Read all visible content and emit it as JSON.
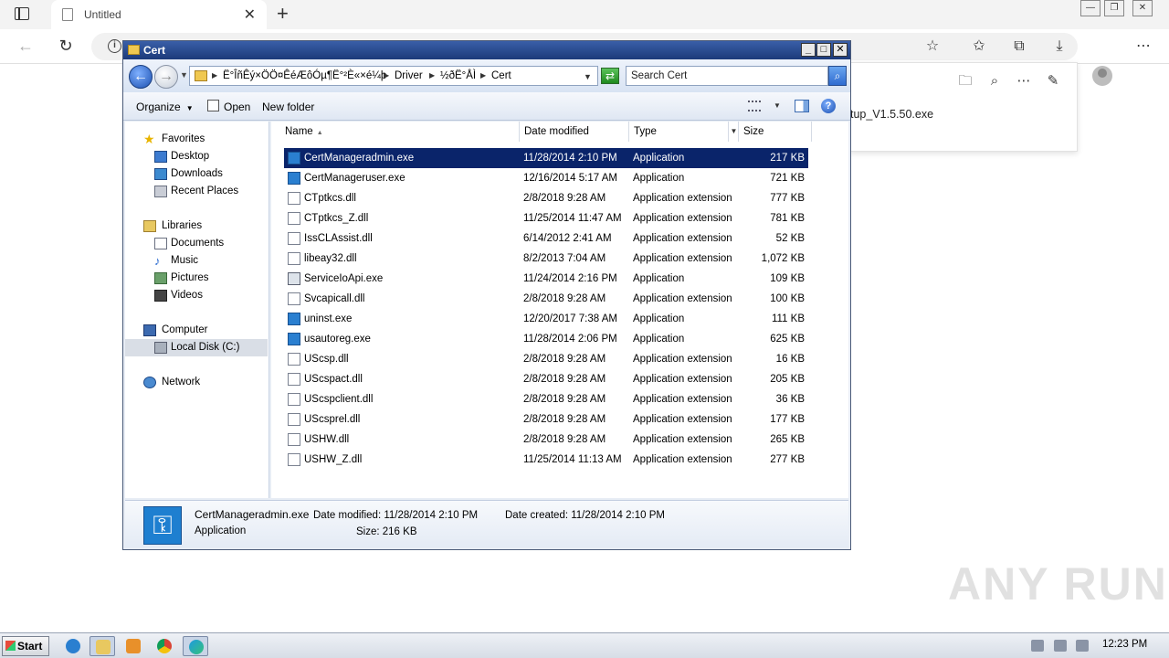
{
  "browser": {
    "tab_title": "Untitled",
    "download_filename": "tup_V1.5.50.exe"
  },
  "explorer": {
    "title": "Cert",
    "breadcrumbs": [
      "Ë°ÎñÊý×ÖÖ¤ÊéÆôÓµ¶Ë°²È«×é¼þ",
      "Driver",
      "½ðË°ÅÌ",
      "Cert"
    ],
    "search_placeholder": "Search Cert",
    "commands": {
      "organize": "Organize",
      "open": "Open",
      "new_folder": "New folder"
    },
    "nav": {
      "favorites": "Favorites",
      "desktop": "Desktop",
      "downloads": "Downloads",
      "recent_places": "Recent Places",
      "libraries": "Libraries",
      "documents": "Documents",
      "music": "Music",
      "pictures": "Pictures",
      "videos": "Videos",
      "computer": "Computer",
      "local_disk": "Local Disk (C:)",
      "network": "Network"
    },
    "columns": {
      "name": "Name",
      "date": "Date modified",
      "type": "Type",
      "size": "Size"
    },
    "files": [
      {
        "name": "CertManageradmin.exe",
        "date": "11/28/2014 2:10 PM",
        "type": "Application",
        "size": "217 KB",
        "icon": "key-icon",
        "selected": true
      },
      {
        "name": "CertManageruser.exe",
        "date": "12/16/2014 5:17 AM",
        "type": "Application",
        "size": "721 KB",
        "icon": "key-icon"
      },
      {
        "name": "CTptkcs.dll",
        "date": "2/8/2018 9:28 AM",
        "type": "Application extension",
        "size": "777 KB",
        "icon": "dll-icon"
      },
      {
        "name": "CTptkcs_Z.dll",
        "date": "11/25/2014 11:47 AM",
        "type": "Application extension",
        "size": "781 KB",
        "icon": "dll-icon"
      },
      {
        "name": "IssCLAssist.dll",
        "date": "6/14/2012 2:41 AM",
        "type": "Application extension",
        "size": "52 KB",
        "icon": "dll-icon"
      },
      {
        "name": "libeay32.dll",
        "date": "8/2/2013 7:04 AM",
        "type": "Application extension",
        "size": "1,072 KB",
        "icon": "dll-icon"
      },
      {
        "name": "ServiceIoApi.exe",
        "date": "11/24/2014 2:16 PM",
        "type": "Application",
        "size": "109 KB",
        "icon": "app-icon"
      },
      {
        "name": "Svcapicall.dll",
        "date": "2/8/2018 9:28 AM",
        "type": "Application extension",
        "size": "100 KB",
        "icon": "dll-icon"
      },
      {
        "name": "uninst.exe",
        "date": "12/20/2017 7:38 AM",
        "type": "Application",
        "size": "111 KB",
        "icon": "key-icon"
      },
      {
        "name": "usautoreg.exe",
        "date": "11/28/2014 2:06 PM",
        "type": "Application",
        "size": "625 KB",
        "icon": "key-icon"
      },
      {
        "name": "UScsp.dll",
        "date": "2/8/2018 9:28 AM",
        "type": "Application extension",
        "size": "16 KB",
        "icon": "dll-icon"
      },
      {
        "name": "UScspact.dll",
        "date": "2/8/2018 9:28 AM",
        "type": "Application extension",
        "size": "205 KB",
        "icon": "dll-icon"
      },
      {
        "name": "UScspclient.dll",
        "date": "2/8/2018 9:28 AM",
        "type": "Application extension",
        "size": "36 KB",
        "icon": "dll-icon"
      },
      {
        "name": "UScsprel.dll",
        "date": "2/8/2018 9:28 AM",
        "type": "Application extension",
        "size": "177 KB",
        "icon": "dll-icon"
      },
      {
        "name": "USHW.dll",
        "date": "2/8/2018 9:28 AM",
        "type": "Application extension",
        "size": "265 KB",
        "icon": "dll-icon"
      },
      {
        "name": "USHW_Z.dll",
        "date": "11/25/2014 11:13 AM",
        "type": "Application extension",
        "size": "277 KB",
        "icon": "dll-icon"
      }
    ],
    "details": {
      "filename": "CertManageradmin.exe",
      "type": "Application",
      "date_modified": "Date modified: 11/28/2014 2:10 PM",
      "size": "Size: 216 KB",
      "date_created": "Date created: 11/28/2014 2:10 PM"
    }
  },
  "watermark": "ANY RUN",
  "taskbar": {
    "start_label": "Start",
    "clock": "12:23 PM"
  }
}
